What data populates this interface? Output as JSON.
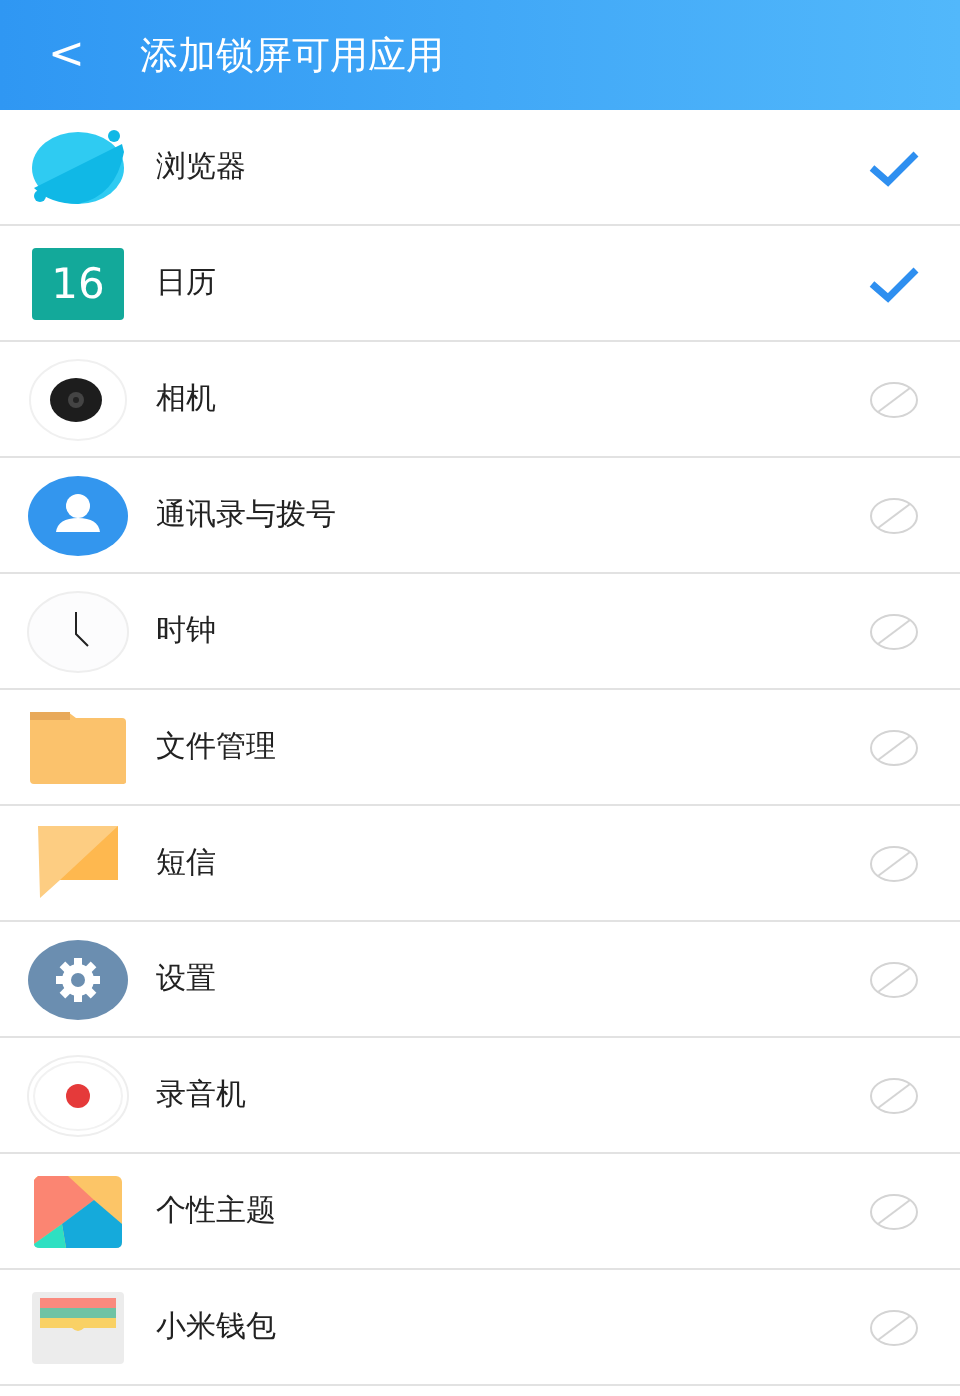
{
  "header": {
    "back_glyph": "<",
    "title": "添加锁屏可用应用"
  },
  "apps": [
    {
      "name": "浏览器",
      "selected": true
    },
    {
      "icon_text": "16",
      "name": "日历",
      "selected": true
    },
    {
      "name": "相机",
      "selected": false
    },
    {
      "name": "通讯录与拨号",
      "selected": false
    },
    {
      "name": "时钟",
      "selected": false
    },
    {
      "name": "文件管理",
      "selected": false
    },
    {
      "name": "短信",
      "selected": false
    },
    {
      "name": "设置",
      "selected": false
    },
    {
      "name": "录音机",
      "selected": false
    },
    {
      "name": "个性主题",
      "selected": false
    },
    {
      "name": "小米钱包",
      "selected": false
    }
  ]
}
